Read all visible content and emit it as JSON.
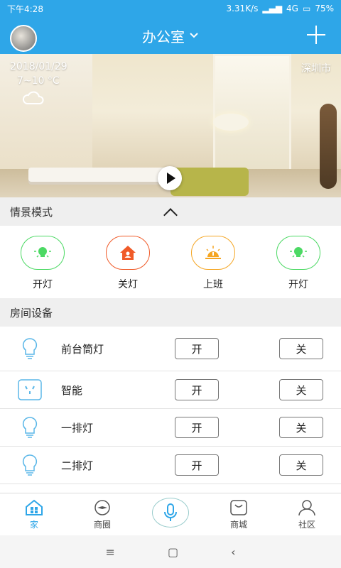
{
  "status": {
    "time": "下午4:28",
    "speed": "3.31K/s",
    "network": "4G",
    "battery": "75%"
  },
  "header": {
    "title": "办公室"
  },
  "hero": {
    "date": "2018/01/29",
    "temperature": "7~10 °C",
    "city": "深圳市"
  },
  "scene_section": {
    "title": "情景模式",
    "items": [
      {
        "label": "开灯",
        "icon": "bulb-icon",
        "color": "#4cd964"
      },
      {
        "label": "关灯",
        "icon": "home-icon",
        "color": "#f05a28"
      },
      {
        "label": "上班",
        "icon": "sunrise-icon",
        "color": "#f5a623"
      },
      {
        "label": "开灯",
        "icon": "bulb-icon",
        "color": "#4cd964"
      }
    ]
  },
  "device_section": {
    "title": "房间设备",
    "on_label": "开",
    "off_label": "关",
    "items": [
      {
        "name": "前台筒灯",
        "icon": "lightbulb-icon"
      },
      {
        "name": "智能",
        "icon": "socket-icon"
      },
      {
        "name": "一排灯",
        "icon": "lightbulb-icon"
      },
      {
        "name": "二排灯",
        "icon": "lightbulb-icon"
      }
    ]
  },
  "tabs": [
    {
      "label": "家",
      "icon": "home-icon",
      "active": true
    },
    {
      "label": "商圈",
      "icon": "compass-icon",
      "active": false
    },
    {
      "label": "",
      "icon": "mic-icon",
      "active": false
    },
    {
      "label": "商城",
      "icon": "bag-icon",
      "active": false
    },
    {
      "label": "社区",
      "icon": "person-icon",
      "active": false
    }
  ],
  "colors": {
    "primary": "#2ea6e8",
    "bulb_blue": "#5bb7e8"
  }
}
